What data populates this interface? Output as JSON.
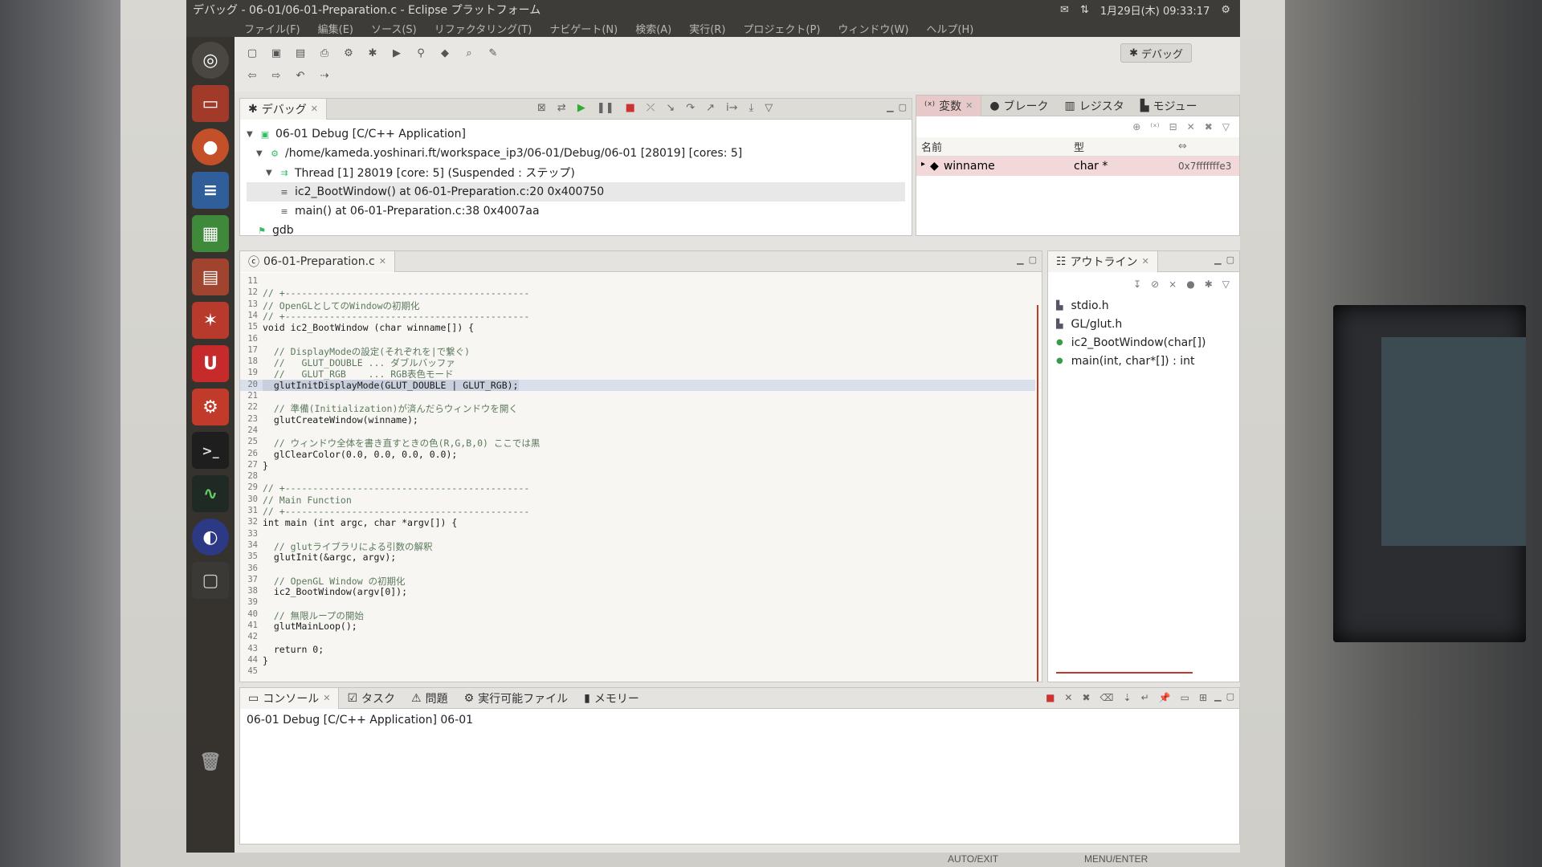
{
  "window": {
    "title": "デバッグ - 06-01/06-01-Preparation.c - Eclipse プラットフォーム",
    "clock": "1月29日(木) 09:33:17"
  },
  "menu": [
    "ファイル(F)",
    "編集(E)",
    "ソース(S)",
    "リファクタリング(T)",
    "ナビゲート(N)",
    "検索(A)",
    "実行(R)",
    "プロジェクト(P)",
    "ウィンドウ(W)",
    "ヘルプ(H)"
  ],
  "perspective": {
    "label": "デバッグ"
  },
  "debug_view": {
    "tab": "デバッグ",
    "rows": [
      {
        "text": "06-01 Debug [C/C++ Application]",
        "indent": 0
      },
      {
        "text": "/home/kameda.yoshinari.ft/workspace_ip3/06-01/Debug/06-01 [28019] [cores: 5]",
        "indent": 1
      },
      {
        "text": "Thread [1] 28019 [core: 5] (Suspended : ステップ)",
        "indent": 2
      },
      {
        "text": "ic2_BootWindow() at 06-01-Preparation.c:20 0x400750",
        "indent": 3
      },
      {
        "text": "main() at 06-01-Preparation.c:38 0x4007aa",
        "indent": 3
      },
      {
        "text": "gdb",
        "indent": 1
      }
    ]
  },
  "variables_view": {
    "tabs": [
      "変数",
      "ブレーク",
      "レジスタ",
      "モジュー"
    ],
    "col_name": "名前",
    "col_type": "型",
    "row": {
      "name": "winname",
      "type": "char *",
      "value": "0x7fffffffe3"
    }
  },
  "editor": {
    "tab": "06-01-Preparation.c",
    "lines": [
      {
        "n": "11",
        "t": ""
      },
      {
        "n": "12",
        "t": "// +--------------------------------------------",
        "c": true
      },
      {
        "n": "13",
        "t": "// OpenGLとしてのWindowの初期化",
        "c": true
      },
      {
        "n": "14",
        "t": "// +--------------------------------------------",
        "c": true
      },
      {
        "n": "15",
        "t": "void ic2_BootWindow (char winname[]) {"
      },
      {
        "n": "16",
        "t": ""
      },
      {
        "n": "17",
        "t": "  // DisplayModeの設定(それぞれを|で繋ぐ)",
        "c": true
      },
      {
        "n": "18",
        "t": "  //   GLUT_DOUBLE ... ダブルバッファ",
        "c": true
      },
      {
        "n": "19",
        "t": "  //   GLUT_RGB    ... RGB表色モード",
        "c": true
      },
      {
        "n": "20",
        "t": "  glutInitDisplayMode(GLUT_DOUBLE | GLUT_RGB);",
        "hl": true
      },
      {
        "n": "21",
        "t": ""
      },
      {
        "n": "22",
        "t": "  // 準備(Initialization)が済んだらウィンドウを開く",
        "c": true
      },
      {
        "n": "23",
        "t": "  glutCreateWindow(winname);"
      },
      {
        "n": "24",
        "t": ""
      },
      {
        "n": "25",
        "t": "  // ウィンドウ全体を書き直すときの色(R,G,B,0) ここでは黒",
        "c": true
      },
      {
        "n": "26",
        "t": "  glClearColor(0.0, 0.0, 0.0, 0.0);"
      },
      {
        "n": "27",
        "t": "}"
      },
      {
        "n": "28",
        "t": ""
      },
      {
        "n": "29",
        "t": "// +--------------------------------------------",
        "c": true
      },
      {
        "n": "30",
        "t": "// Main Function",
        "c": true
      },
      {
        "n": "31",
        "t": "// +--------------------------------------------",
        "c": true
      },
      {
        "n": "32",
        "t": "int main (int argc, char *argv[]) {"
      },
      {
        "n": "33",
        "t": ""
      },
      {
        "n": "34",
        "t": "  // glutライブラリによる引数の解釈",
        "c": true
      },
      {
        "n": "35",
        "t": "  glutInit(&argc, argv);"
      },
      {
        "n": "36",
        "t": ""
      },
      {
        "n": "37",
        "t": "  // OpenGL Window の初期化",
        "c": true
      },
      {
        "n": "38",
        "t": "  ic2_BootWindow(argv[0]);"
      },
      {
        "n": "39",
        "t": ""
      },
      {
        "n": "40",
        "t": "  // 無限ループの開始",
        "c": true
      },
      {
        "n": "41",
        "t": "  glutMainLoop();"
      },
      {
        "n": "42",
        "t": ""
      },
      {
        "n": "43",
        "t": "  return 0;"
      },
      {
        "n": "44",
        "t": "}"
      },
      {
        "n": "45",
        "t": ""
      }
    ]
  },
  "outline_view": {
    "tab": "アウトライン",
    "items": [
      {
        "label": "stdio.h",
        "kind": "include"
      },
      {
        "label": "GL/glut.h",
        "kind": "include"
      },
      {
        "label": "ic2_BootWindow(char[])",
        "kind": "function"
      },
      {
        "label": "main(int, char*[]) : int",
        "kind": "function"
      }
    ]
  },
  "console_view": {
    "tabs": [
      "コンソール",
      "タスク",
      "問題",
      "実行可能ファイル",
      "メモリー"
    ],
    "text": "06-01 Debug [C/C++ Application] 06-01"
  },
  "bezel": {
    "left_label": "AUTO/EXIT",
    "right_label": "MENU/ENTER"
  }
}
